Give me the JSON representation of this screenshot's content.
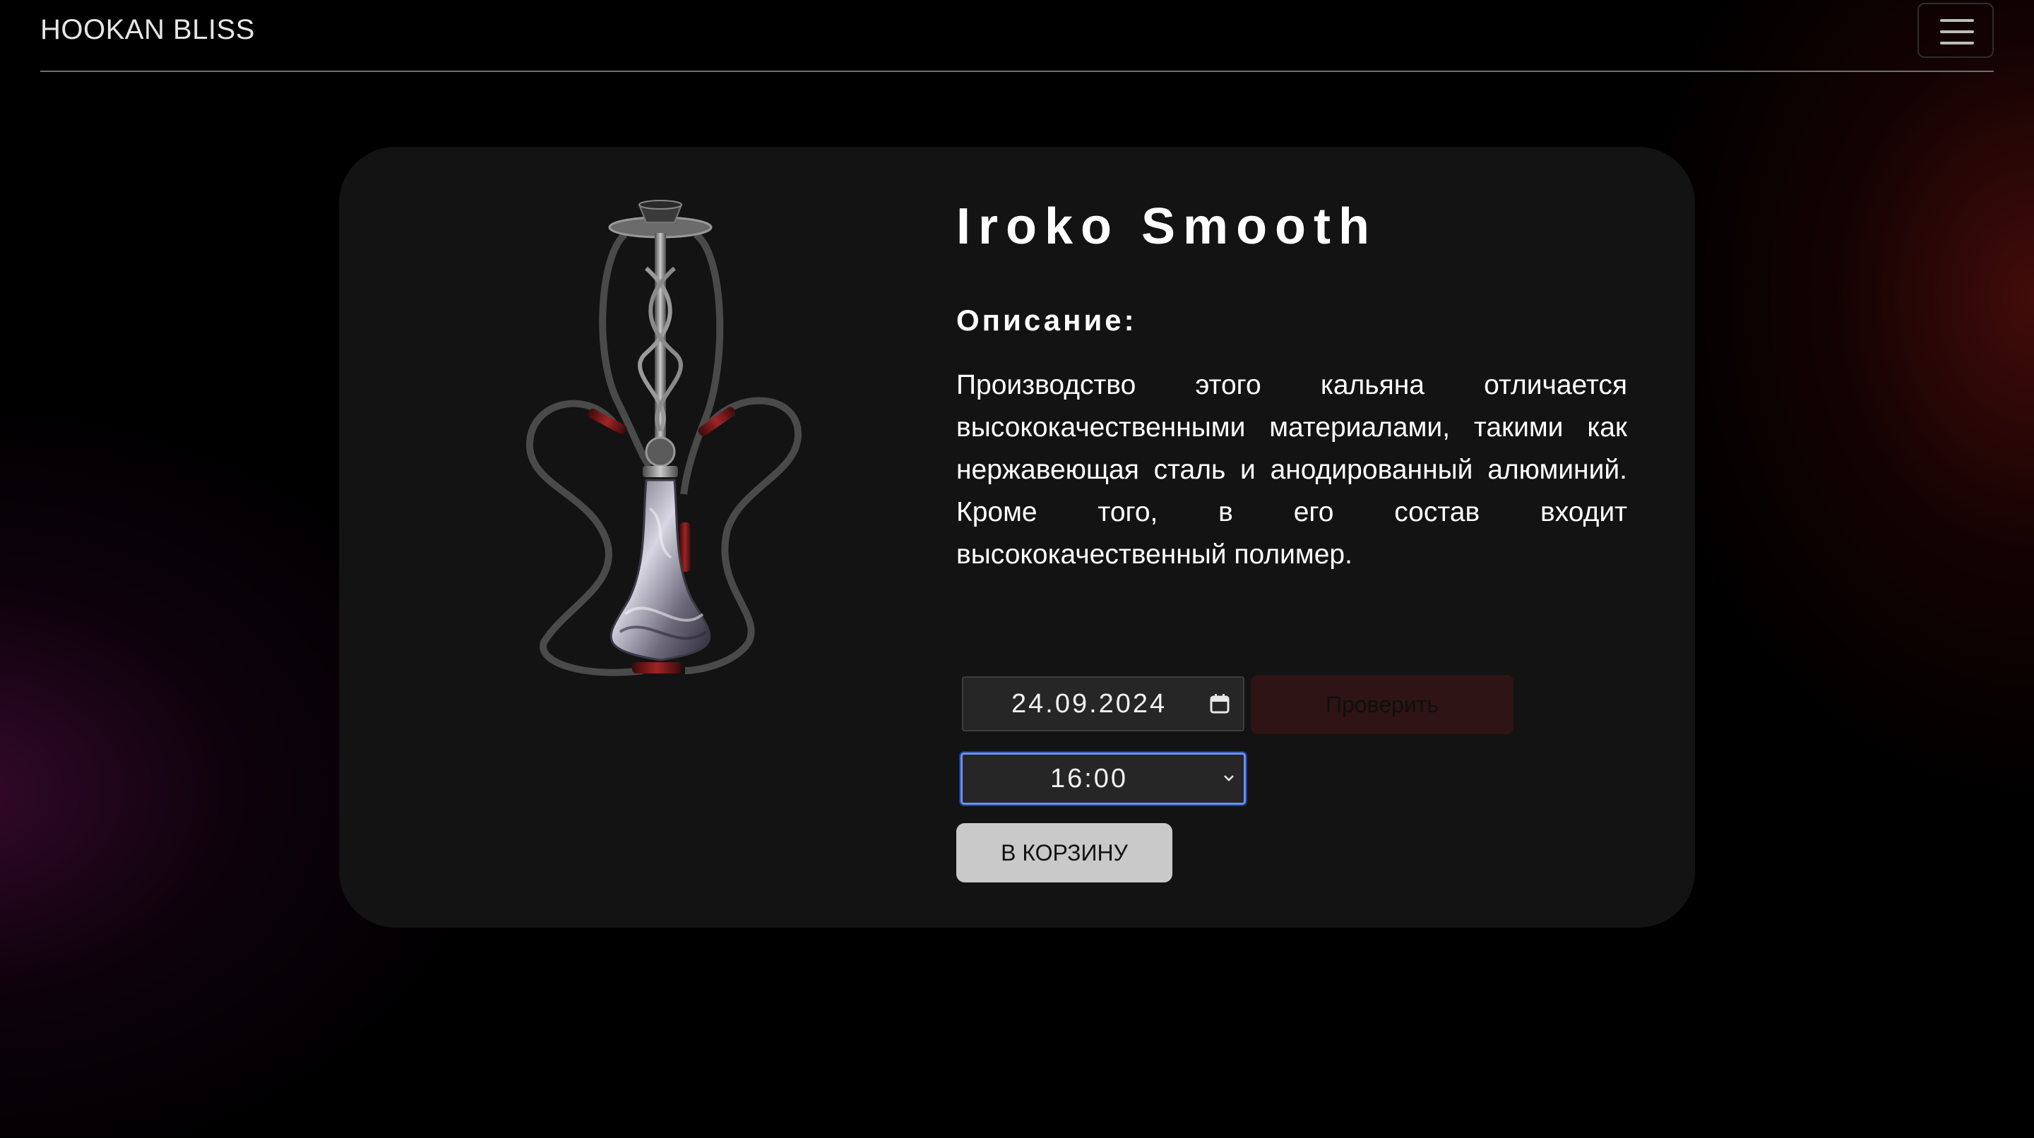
{
  "navbar": {
    "brand": "HOOKAN BLISS",
    "menu_icon": "hamburger-menu-icon"
  },
  "product": {
    "title": "Iroko Smooth",
    "description_heading": "Описание:",
    "description": "Производство этого кальяна отличается высококачественными материалами, такими как нержавеющая сталь и анодированный алюминий. Кроме того, в его состав входит высококачественный полимер.",
    "image_icon": "hookah-image"
  },
  "booking": {
    "date_value": "24.09.2024",
    "date_icon": "calendar-icon",
    "check_label": "Проверить",
    "time_value": "16:00",
    "time_icon": "chevron-down-icon",
    "cart_label": "В КОРЗИНУ"
  },
  "colors": {
    "card_background": "#131313",
    "check_button": "#2e1414",
    "cart_button": "#c9c9c9",
    "focus_ring": "#6d8ff0"
  }
}
